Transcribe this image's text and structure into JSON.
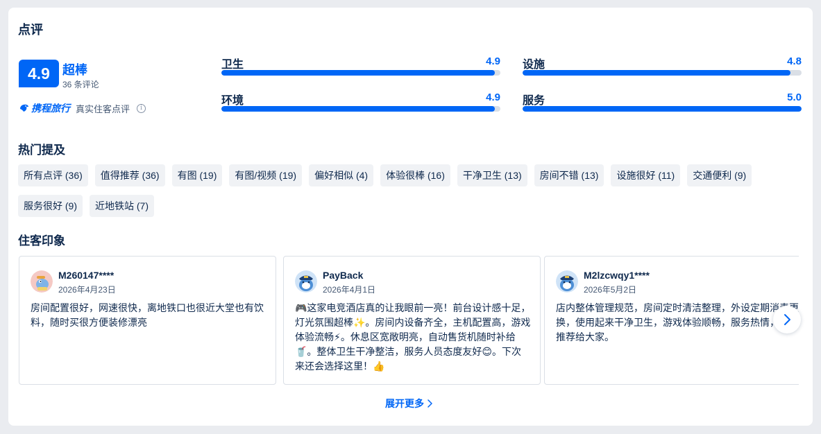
{
  "section": {
    "title": "点评"
  },
  "summary": {
    "score": "4.9",
    "score_word": "超棒",
    "review_count": "36 条评论",
    "brand": "携程旅行",
    "brand_note": "真实住客点评",
    "info_icon": "i"
  },
  "ratings": [
    {
      "label": "卫生",
      "value": "4.9",
      "fraction": 0.98
    },
    {
      "label": "设施",
      "value": "4.8",
      "fraction": 0.96
    },
    {
      "label": "环境",
      "value": "4.9",
      "fraction": 0.98
    },
    {
      "label": "服务",
      "value": "5.0",
      "fraction": 1.0
    }
  ],
  "hot_mentions": {
    "title": "热门提及",
    "tags": [
      "所有点评 (36)",
      "值得推荐 (36)",
      "有图 (19)",
      "有图/视频 (19)",
      "偏好相似 (4)",
      "体验很棒 (16)",
      "干净卫生 (13)",
      "房间不错 (13)",
      "设施很好 (11)",
      "交通便利 (9)",
      "服务很好 (9)",
      "近地铁站 (7)"
    ]
  },
  "impressions": {
    "title": "住客印象",
    "reviews": [
      {
        "name": "M260147****",
        "date": "2026年4月23日",
        "text": "房间配置很好，网速很快，离地铁口也很近大堂也有饮料，随时买很方便装修漂亮",
        "avatar": "dolphin-pink"
      },
      {
        "name": "PayBack",
        "date": "2026年4月1日",
        "text": "🎮这家电竞酒店真的让我眼前一亮！前台设计感十足，灯光氛围超棒✨。房间内设备齐全，主机配置高，游戏体验流畅⚡。休息区宽敞明亮，自动售货机随时补给🥤。整体卫生干净整洁，服务人员态度友好😊。下次来还会选择这里！👍",
        "avatar": "dolphin-blue"
      },
      {
        "name": "M2lzcwqy1****",
        "date": "2026年5月2日",
        "text": "店内整体管理规范，房间定时清洁整理，外设定期消毒更换，使用起来干净卫生，游戏体验顺畅，服务热情，真心推荐给大家。",
        "avatar": "dolphin-blue"
      }
    ]
  },
  "actions": {
    "expand_more": "展开更多",
    "next_icon": "chevron-right-icon"
  },
  "colors": {
    "accent": "#0066f6",
    "text": "#0f294d",
    "bar_track": "#dadfe6",
    "tag_bg": "#f0f2f5"
  }
}
